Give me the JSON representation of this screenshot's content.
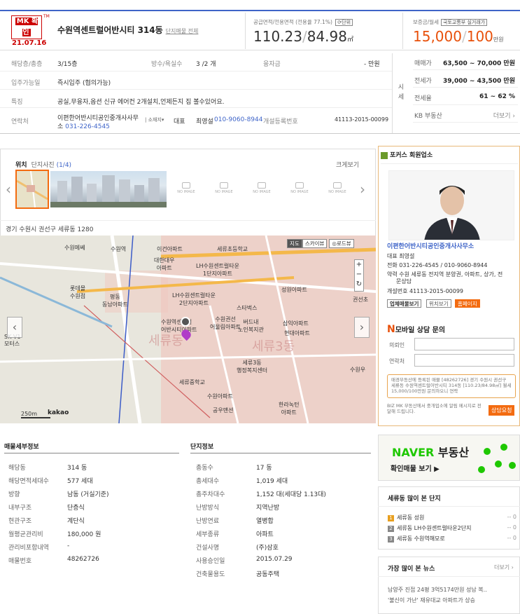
{
  "header": {
    "badge_top": "MK 확인",
    "badge_tm": "TM",
    "badge_date": "21.07.16",
    "title": "수원역센트럴어반시티 314동",
    "complex_link": "단지매물 전체",
    "area_label": "공급면적/전용면적 (전용율 77.1%)",
    "area_unit_btn": "단위",
    "area_supply": "110.23",
    "area_excl": "84.98",
    "area_unit": "㎡",
    "deposit_label": "보증금/월세",
    "deposit_btn": "국토교통부 실거래가",
    "deposit": "15,000",
    "monthly": "100",
    "price_unit": "만원"
  },
  "info": {
    "floor_label": "해당층/총층",
    "floor": "3/15층",
    "rooms_label": "방수/욕실수",
    "rooms": "3 /2 개",
    "loan_label": "융자금",
    "loan": "- 만원",
    "movein_label": "입주가능일",
    "movein": "즉시입주 (협의가능)",
    "feature_label": "특징",
    "feature": "공실,무융자,옵션 신규 에어컨 2개설치,언제든지 집 볼수있어요.",
    "contact_label": "연락처",
    "agency": "이편한어반시티공인중개사사무소",
    "agency_phone": "031-226-4545",
    "loc_btn": "소재지",
    "rep_label": "대표",
    "rep_name": "최영설",
    "rep_phone": "010-9060-8944",
    "reg_label": "개설등록번호",
    "reg_no": "41113-2015-00099"
  },
  "sise": {
    "label": "시세",
    "rows": [
      {
        "label": "매매가",
        "value": "63,500 ~ 70,000 만원"
      },
      {
        "label": "전세가",
        "value": "39,000 ~ 43,500 만원"
      },
      {
        "label": "전세율",
        "value": "61 ~ 62 %"
      },
      {
        "label": "KB 부동산",
        "value": "더보기 ›"
      }
    ]
  },
  "map": {
    "tab_location": "위치",
    "tab_photos": "단지사진",
    "tab_count": "(1/4)",
    "enlarge": "크게보기",
    "noimage": "NO IMAGE",
    "address": "경기 수원시 권선구 세류동 1280",
    "btn_map": "지도",
    "btn_sky": "스카이뷰",
    "btn_road": "로드뷰",
    "scale": "250m",
    "kakao": "kakao",
    "labels": [
      "수원메쎄",
      "수원역",
      "이건아파트",
      "세류초등학교",
      "대한대우\n아파트",
      "LH수원센트럴타운\n1단지아파트",
      "롯데몰\n수원점",
      "평동\n동남아파트",
      "LH수원센트럴타운\n2단지아파트",
      "성원아파트",
      "스타벅스",
      "권선초",
      "수원역센트럴\n어반시티아파트",
      "버드내\n노인복지관",
      "삼익아파트",
      "현대아파트",
      "수원권선\n어울림아파트",
      "세류3동\n행정복지센터",
      "SK V1\n모터스",
      "세류중학교",
      "수원아파트",
      "한라녹턴\n아파트",
      "수원우",
      "공우맨션",
      "세류동",
      "세류3동"
    ]
  },
  "detail": {
    "title": "매물세부정보",
    "rows": [
      {
        "k": "해당동",
        "v": "314 동"
      },
      {
        "k": "해당면적세대수",
        "v": "577 세대"
      },
      {
        "k": "방향",
        "v": "남동 (거실기준)"
      },
      {
        "k": "내부구조",
        "v": "단층식"
      },
      {
        "k": "현관구조",
        "v": "계단식"
      },
      {
        "k": "월평균관리비",
        "v": "180,000 원"
      },
      {
        "k": "관리비포함내역",
        "v": "-"
      },
      {
        "k": "매물번호",
        "v": "48262726"
      }
    ]
  },
  "complex": {
    "title": "단지정보",
    "rows": [
      {
        "k": "총동수",
        "v": "17 동"
      },
      {
        "k": "총세대수",
        "v": "1,019 세대"
      },
      {
        "k": "총주차대수",
        "v": "1,152 대(세대당 1.13대)"
      },
      {
        "k": "난방방식",
        "v": "지역난방"
      },
      {
        "k": "난방연료",
        "v": "열병합"
      },
      {
        "k": "세부종류",
        "v": "아파트"
      },
      {
        "k": "건설사명",
        "v": "(주)삼호"
      },
      {
        "k": "사용승인일",
        "v": "2015.07.29"
      },
      {
        "k": "건축물용도",
        "v": "공동주택"
      }
    ]
  },
  "side": {
    "header": "포커스 회원업소",
    "agency": "이편한어반시티공인중개사사무소",
    "rep": "대표 최영설",
    "tel": "전화 031-226-4545 / 010-9060-8944",
    "desc1": "약력 수원 세류동 전지역 분양권, 아파트, 상가, 전",
    "desc2": "문상담",
    "reg": "개설번호 41113-2015-00099",
    "btn1": "업체매물보기",
    "btn2": "위치보기",
    "btn3": "홈페이지",
    "mobile_n": "N",
    "mobile_title": "모바일 상담 문의",
    "name_label": "의뢰인",
    "contact_label": "연락처",
    "note": "매경부동산에 등록된 매물 [48262726] 경기 수원시 권선구 세류동 수원역센트럴어반시티 314동 [110.23/84.98㎡] 월세 15,000/100만원 문의하오니 연락",
    "note2": "BIZ MK 부동산에서 중개업소에 알림 메시지로 전달해 드립니다.",
    "consult_btn": "상담요청"
  },
  "naver": {
    "brand": "NAVER",
    "brand2": "부동산",
    "sub": "확인매물 보기"
  },
  "popular": {
    "title": "세류동 많이 본 단지",
    "items": [
      {
        "rank": "1",
        "name": "세류동 성원",
        "val": "-- 0"
      },
      {
        "rank": "2",
        "name": "세류동 LH수원센트럴타운2단지",
        "val": "-- 0"
      },
      {
        "rank": "3",
        "name": "세류동 수원역해모로",
        "val": "-- 0"
      }
    ],
    "colors": [
      "#e8a020",
      "#888888",
      "#888888"
    ]
  },
  "news": {
    "title": "가장 많이 본 뉴스",
    "more": "더보기 ›",
    "items": [
      "남양주 진접 24평 3억5174만원 성남 복..",
      "'불신이 가난' 재유대교 아파트가 상승"
    ]
  }
}
